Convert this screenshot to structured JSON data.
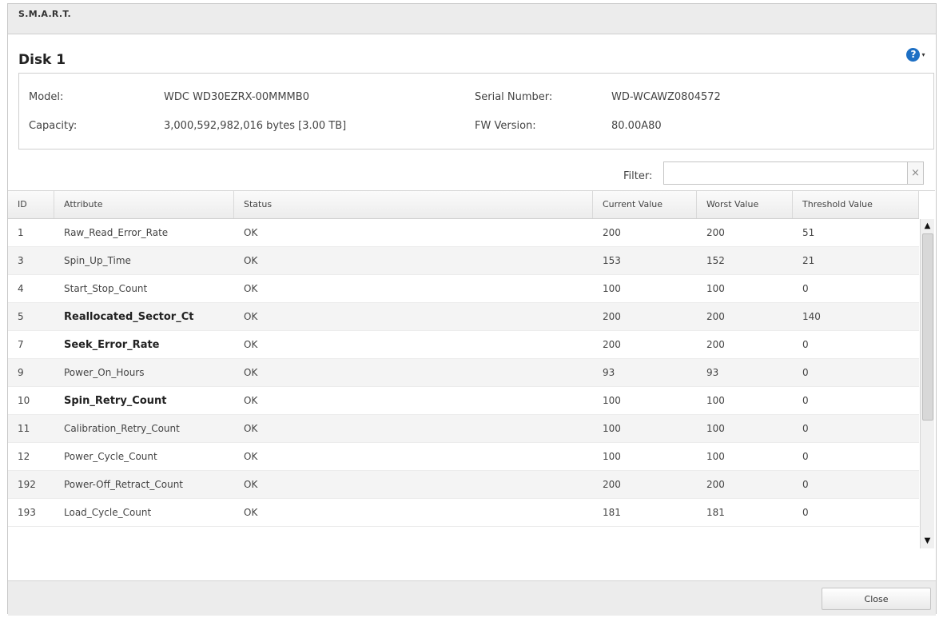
{
  "window": {
    "title": "S.M.A.R.T."
  },
  "help": {
    "icon": "help-icon",
    "glyph": "?",
    "caret": "▾"
  },
  "disk": {
    "title": "Disk 1",
    "model_label": "Model:",
    "model_value": "WDC WD30EZRX-00MMMB0",
    "capacity_label": "Capacity:",
    "capacity_value": "3,000,592,982,016 bytes [3.00 TB]",
    "serial_label": "Serial Number:",
    "serial_value": "WD-WCAWZ0804572",
    "fw_label": "FW Version:",
    "fw_value": "80.00A80"
  },
  "filter": {
    "label": "Filter:",
    "value": "",
    "clear_glyph": "×"
  },
  "table": {
    "columns": [
      "ID",
      "Attribute",
      "Status",
      "Current Value",
      "Worst Value",
      "Threshold Value"
    ],
    "rows": [
      {
        "id": "1",
        "attribute": "Raw_Read_Error_Rate",
        "status": "OK",
        "current": "200",
        "worst": "200",
        "threshold": "51",
        "bold": false
      },
      {
        "id": "3",
        "attribute": "Spin_Up_Time",
        "status": "OK",
        "current": "153",
        "worst": "152",
        "threshold": "21",
        "bold": false
      },
      {
        "id": "4",
        "attribute": "Start_Stop_Count",
        "status": "OK",
        "current": "100",
        "worst": "100",
        "threshold": "0",
        "bold": false
      },
      {
        "id": "5",
        "attribute": "Reallocated_Sector_Ct",
        "status": "OK",
        "current": "200",
        "worst": "200",
        "threshold": "140",
        "bold": true
      },
      {
        "id": "7",
        "attribute": "Seek_Error_Rate",
        "status": "OK",
        "current": "200",
        "worst": "200",
        "threshold": "0",
        "bold": true
      },
      {
        "id": "9",
        "attribute": "Power_On_Hours",
        "status": "OK",
        "current": "93",
        "worst": "93",
        "threshold": "0",
        "bold": false
      },
      {
        "id": "10",
        "attribute": "Spin_Retry_Count",
        "status": "OK",
        "current": "100",
        "worst": "100",
        "threshold": "0",
        "bold": true
      },
      {
        "id": "11",
        "attribute": "Calibration_Retry_Count",
        "status": "OK",
        "current": "100",
        "worst": "100",
        "threshold": "0",
        "bold": false
      },
      {
        "id": "12",
        "attribute": "Power_Cycle_Count",
        "status": "OK",
        "current": "100",
        "worst": "100",
        "threshold": "0",
        "bold": false
      },
      {
        "id": "192",
        "attribute": "Power-Off_Retract_Count",
        "status": "OK",
        "current": "200",
        "worst": "200",
        "threshold": "0",
        "bold": false
      },
      {
        "id": "193",
        "attribute": "Load_Cycle_Count",
        "status": "OK",
        "current": "181",
        "worst": "181",
        "threshold": "0",
        "bold": false
      }
    ]
  },
  "scrollbar": {
    "up_glyph": "▲",
    "down_glyph": "▼"
  },
  "footer": {
    "close_label": "Close"
  },
  "colors": {
    "help_blue": "#1d6fc4",
    "row_alt": "#f4f4f4",
    "border": "#cfcfcf"
  }
}
